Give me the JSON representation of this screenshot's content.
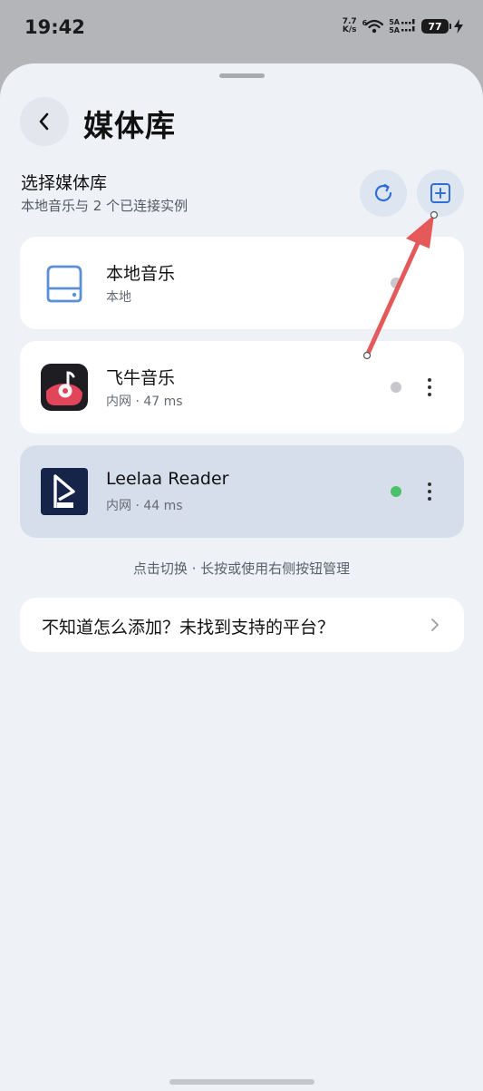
{
  "status_bar": {
    "time": "19:42",
    "net_speed_value": "7.7",
    "net_speed_unit": "K/s",
    "wifi_label": "6",
    "sim1": "5A",
    "sim2": "5A",
    "battery": "77"
  },
  "header": {
    "title": "媒体库"
  },
  "section": {
    "title": "选择媒体库",
    "subtitle": "本地音乐与 2 个已连接实例"
  },
  "libraries": [
    {
      "name": "本地音乐",
      "detail": "本地",
      "status": "offline",
      "icon": "hard-drive-icon"
    },
    {
      "name": "飞牛音乐",
      "detail": "内网 · 47 ms",
      "status": "offline",
      "icon": "feiniu-music-icon"
    },
    {
      "name": "Leelaa Reader",
      "detail": "内网 · 44 ms",
      "status": "online",
      "icon": "leelaa-reader-icon",
      "selected": true
    }
  ],
  "hint": "点击切换 · 长按或使用右侧按钮管理",
  "help": {
    "label": "不知道怎么添加？未找到支持的平台？"
  },
  "colors": {
    "online": "#4cc06a",
    "offline": "#c6c8cc",
    "selected_card": "#d6deeb",
    "annotation_arrow": "#e45a5a"
  }
}
